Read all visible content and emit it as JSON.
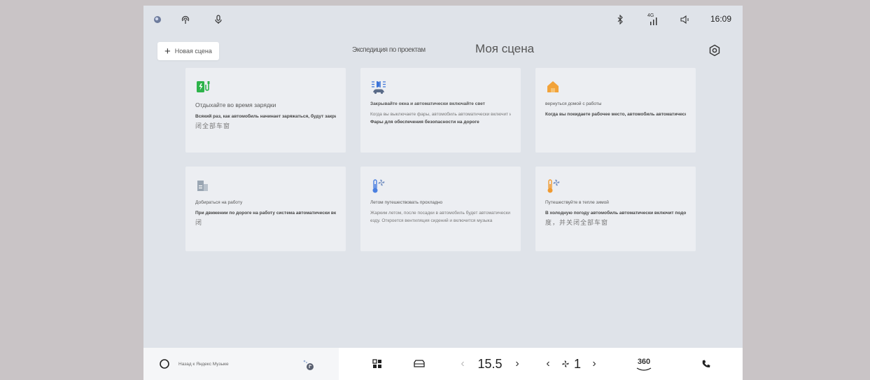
{
  "status_bar": {
    "time": "16:09",
    "network": "4G",
    "icons": [
      "assistant-orb-icon",
      "hotspot-icon",
      "microphone-icon",
      "bluetooth-icon",
      "signal-icon",
      "volume-icon"
    ]
  },
  "header": {
    "new_scene_label": "Новая сцена",
    "other_tab": "Экспедиция по проектам",
    "title": "Моя сцена"
  },
  "cards": [
    {
      "icon": "charging-station-icon",
      "title": "Отдыхайте во время зарядки",
      "desc": "Всякий раз, как автомобиль начинает заряжаться, будут закрыты окна и включён режим отдыха для водителя",
      "desc2": "闭全部车窗"
    },
    {
      "icon": "headlights-icon",
      "title": "Закрывайте окна и автоматически включайте свет",
      "desc": "Когда вы выключаете фары, автомобиль автоматически включит их после того, как начнёт движение",
      "desc_bold": "Фары для обеспечения безопасности на дороге"
    },
    {
      "icon": "home-icon",
      "title": "вернуться домой с работы",
      "desc": "Когда вы покидаете рабочее место, автомобиль автоматически подготовит режим для поездки домой"
    },
    {
      "icon": "office-building-icon",
      "title": "Добираться на работу",
      "desc": "При движении по дороге на работу система автоматически включит режим комфортной поездки для водителя",
      "desc2": "闭"
    },
    {
      "icon": "thermometer-fan-cold-icon",
      "title": "Летом путешествовать прохладно",
      "desc": "Жарким летом, после посадки в автомобиль будет автоматически включён кондиционер, чтобы обеспечить комфортную",
      "desc_line2": "езду. Откроется вентиляция сидений и включится музыка"
    },
    {
      "icon": "thermometer-fan-warm-icon",
      "title": "Путешествуйте в тепле зимой",
      "desc": "В холодную погоду автомобиль автоматически включит подогрев, чтобы регулировать температуру в салоне и на улице.",
      "desc2": "度，并关闭全部车窗"
    }
  ],
  "dock": {
    "voice_hint": "Назад к Яндекс Музыке",
    "temperature": "15.5",
    "fan_level": "1",
    "view_360": "360"
  },
  "colors": {
    "screen_bg": "#dfe3e9",
    "card_bg": "#eceef2",
    "charging_green": "#2db34a",
    "headlight_blue": "#3a72d8",
    "home_orange": "#f2a33a",
    "cold_blue": "#4a7fe0",
    "warm_orange": "#f09a30"
  }
}
